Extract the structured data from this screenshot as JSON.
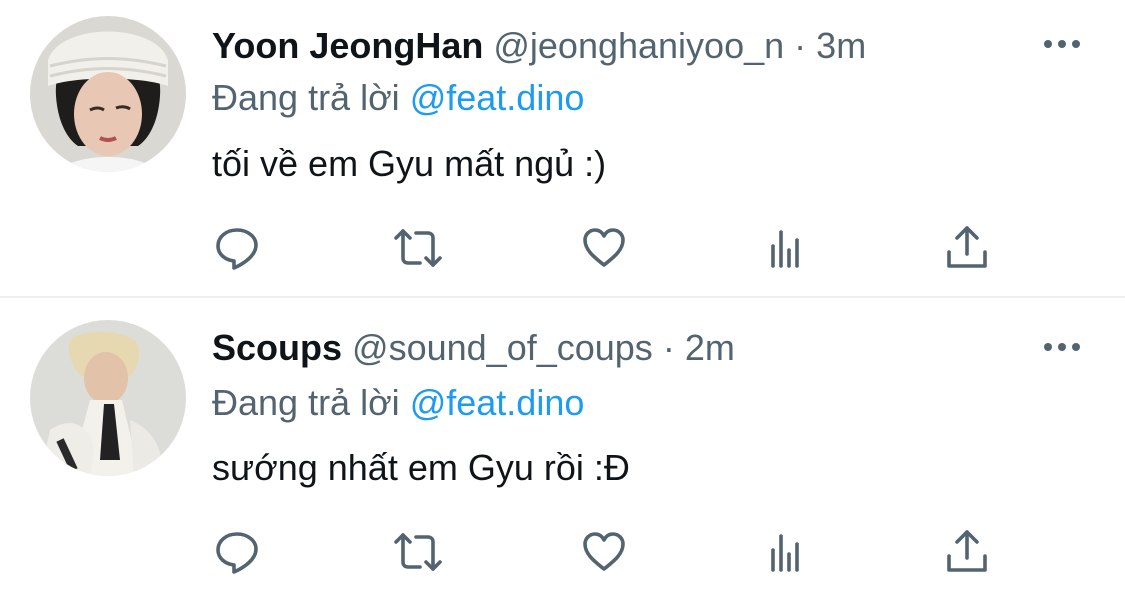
{
  "tweets": [
    {
      "name": "Yoon JeongHan",
      "handle": "@jeonghaniyoo_n",
      "separator": "·",
      "time": "3m",
      "replying_prefix": "Đang trả lời",
      "replying_to": "@feat.dino",
      "text": "tối về em Gyu mất ngủ :)"
    },
    {
      "name": "Scoups",
      "handle": "@sound_of_coups",
      "separator": "·",
      "time": "2m",
      "replying_prefix": "Đang trả lời",
      "replying_to": "@feat.dino",
      "text": "sướng nhất em Gyu rồi :Đ"
    }
  ],
  "icons": {
    "more": "more-horizontal-icon",
    "reply": "reply-bubble-icon",
    "retweet": "retweet-icon",
    "like": "heart-icon",
    "stats": "analytics-icon",
    "share": "share-icon"
  },
  "colors": {
    "text_primary": "#0f1419",
    "text_secondary": "#536471",
    "mention": "#1d9bf0",
    "divider": "#eceef0"
  }
}
